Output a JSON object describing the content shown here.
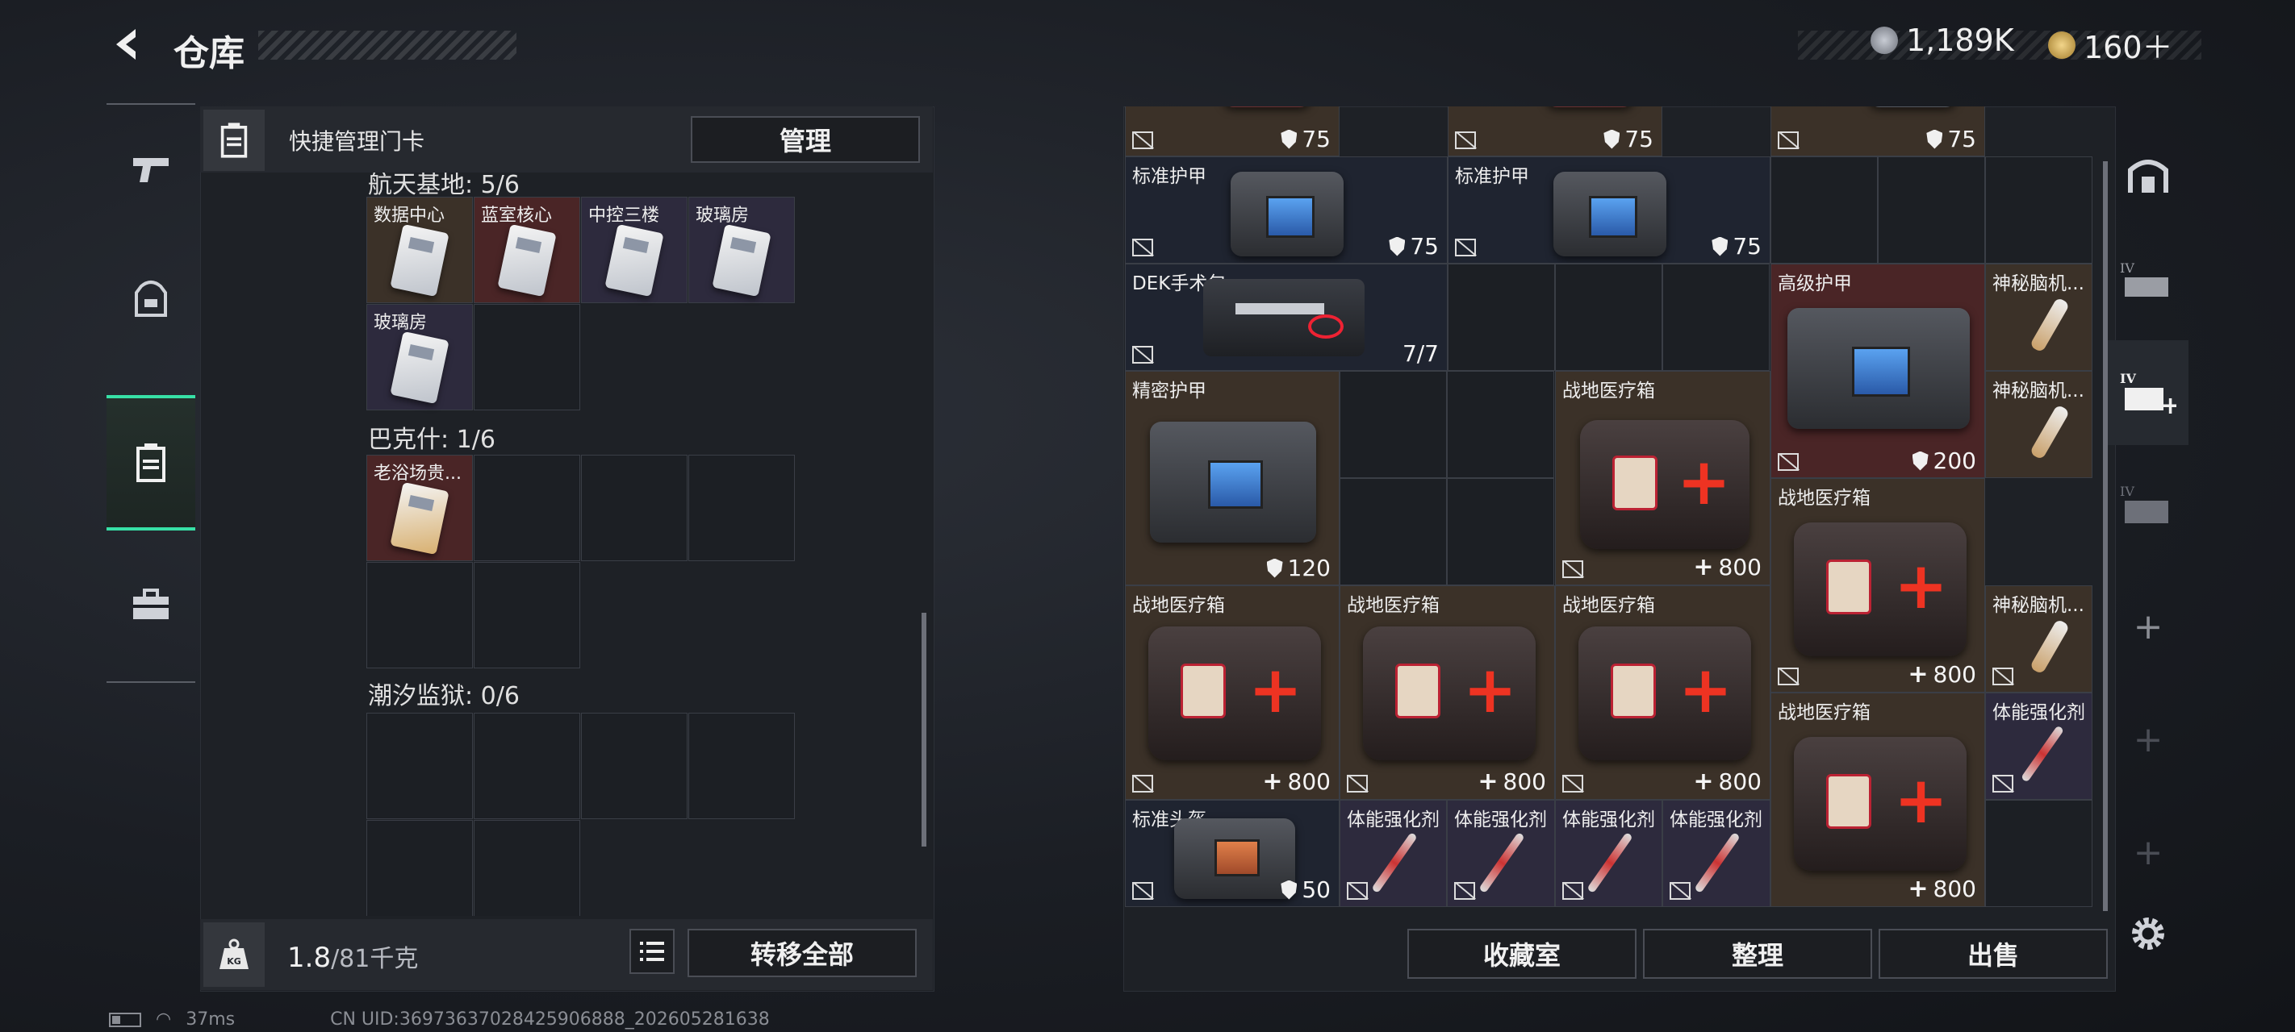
{
  "header": {
    "title": "仓库",
    "currency1": "1,189K",
    "currency2": "160＋"
  },
  "quick_card": {
    "title": "快捷管理门卡",
    "manage_btn": "管理"
  },
  "sections": [
    {
      "title": "航天基地: 5/6",
      "cells": [
        "数据中心",
        "蓝室核心",
        "中控三楼",
        "玻璃房",
        "玻璃房"
      ]
    },
    {
      "title": "巴克什: 1/6",
      "cells": [
        "老浴场贵..."
      ]
    },
    {
      "title": "潮汐监狱: 0/6",
      "cells": []
    }
  ],
  "footer": {
    "weight": "1.8",
    "weight_max": "/81千克",
    "transfer_all": "转移全部",
    "weight_icon": "KG"
  },
  "grid_items": [
    {
      "name": "",
      "value": "75",
      "kind": "shield"
    },
    {
      "name": "",
      "value": "75",
      "kind": "shield"
    },
    {
      "name": "",
      "value": "75",
      "kind": "shield"
    },
    {
      "name": "标准护甲",
      "value": "75",
      "kind": "shield"
    },
    {
      "name": "标准护甲",
      "value": "75",
      "kind": "shield"
    },
    {
      "name": "DEK手术包",
      "value": "7/7",
      "kind": "text"
    },
    {
      "name": "高级护甲",
      "value": "200",
      "kind": "shield"
    },
    {
      "name": "神秘脑机...",
      "value": "",
      "kind": "none"
    },
    {
      "name": "精密护甲",
      "value": "120",
      "kind": "shield"
    },
    {
      "name": "战地医疗箱",
      "value": "800",
      "kind": "plus"
    },
    {
      "name": "神秘脑机...",
      "value": "",
      "kind": "none"
    },
    {
      "name": "战地医疗箱",
      "value": "800",
      "kind": "plus"
    },
    {
      "name": "战地医疗箱",
      "value": "800",
      "kind": "plus"
    },
    {
      "name": "战地医疗箱",
      "value": "800",
      "kind": "plus"
    },
    {
      "name": "战地医疗箱",
      "value": "800",
      "kind": "plus"
    },
    {
      "name": "神秘脑机...",
      "value": "",
      "kind": "none"
    },
    {
      "name": "战地医疗箱",
      "value": "800",
      "kind": "plus"
    },
    {
      "name": "体能强化剂",
      "value": "",
      "kind": "none"
    },
    {
      "name": "标准头盔",
      "value": "50",
      "kind": "shield"
    },
    {
      "name": "体能强化剂",
      "value": "",
      "kind": "none"
    },
    {
      "name": "体能强化剂",
      "value": "",
      "kind": "none"
    },
    {
      "name": "体能强化剂",
      "value": "",
      "kind": "none"
    },
    {
      "name": "体能强化剂",
      "value": "",
      "kind": "none"
    }
  ],
  "bottom_buttons": {
    "collection": "收藏室",
    "organize": "整理",
    "sell": "出售"
  },
  "status": {
    "ping": "37ms",
    "uid": "CN UID:36973637028425906888_202605281638"
  }
}
